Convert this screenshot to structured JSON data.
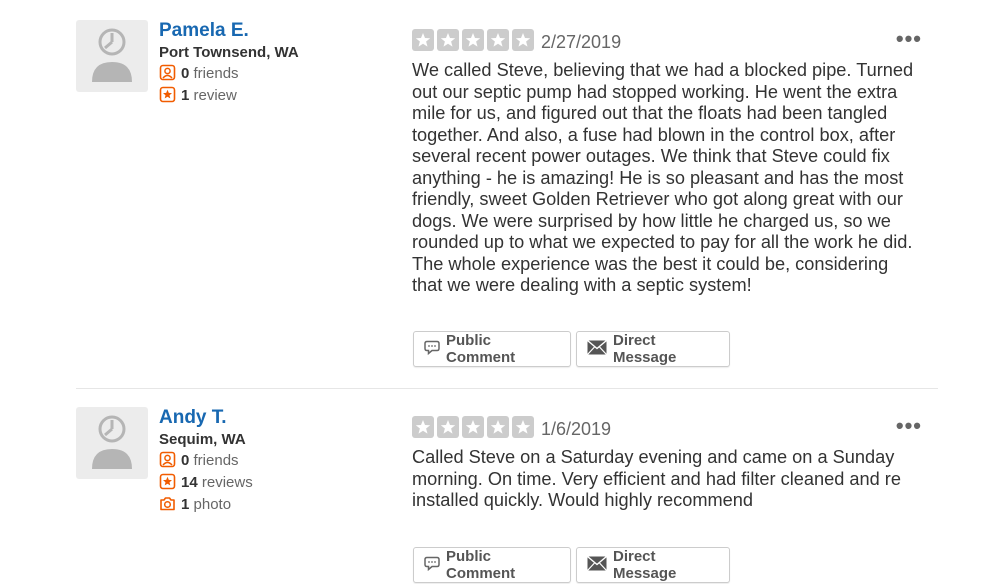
{
  "colors": {
    "accent": "#1868b1",
    "orange": "#f15c00",
    "star_empty": "#cccccc"
  },
  "reviews": [
    {
      "user": {
        "name": "Pamela E.",
        "location": "Port Townsend, WA",
        "friends_count": "0",
        "friends_label": "friends",
        "reviews_count": "1",
        "reviews_label": "review"
      },
      "rating": 0,
      "date": "2/27/2019",
      "text": "We called Steve, believing that we had a blocked pipe. Turned out our septic pump had stopped working. He went the extra mile for us, and figured out that the floats had been tangled together. And also, a fuse had blown in the control box, after several recent power outages.  We think that Steve could fix anything - he is amazing!  He is so pleasant and has the most friendly, sweet Golden Retriever who got along great with our dogs. We were surprised by how little he charged us, so we rounded up to what we expected to pay for all the work he did.\nThe whole experience was the best it could be, considering that we were dealing with a septic system!",
      "more": "•••",
      "public_comment": "Public Comment",
      "direct_message": "Direct Message"
    },
    {
      "user": {
        "name": "Andy T.",
        "location": "Sequim, WA",
        "friends_count": "0",
        "friends_label": "friends",
        "reviews_count": "14",
        "reviews_label": "reviews",
        "photos_count": "1",
        "photos_label": "photo"
      },
      "rating": 0,
      "date": "1/6/2019",
      "text": "Called Steve on a Saturday evening and came on a Sunday morning. On time. Very efficient and had filter cleaned and re installed quickly. Would highly recommend",
      "more": "•••",
      "public_comment": "Public Comment",
      "direct_message": "Direct Message"
    }
  ]
}
